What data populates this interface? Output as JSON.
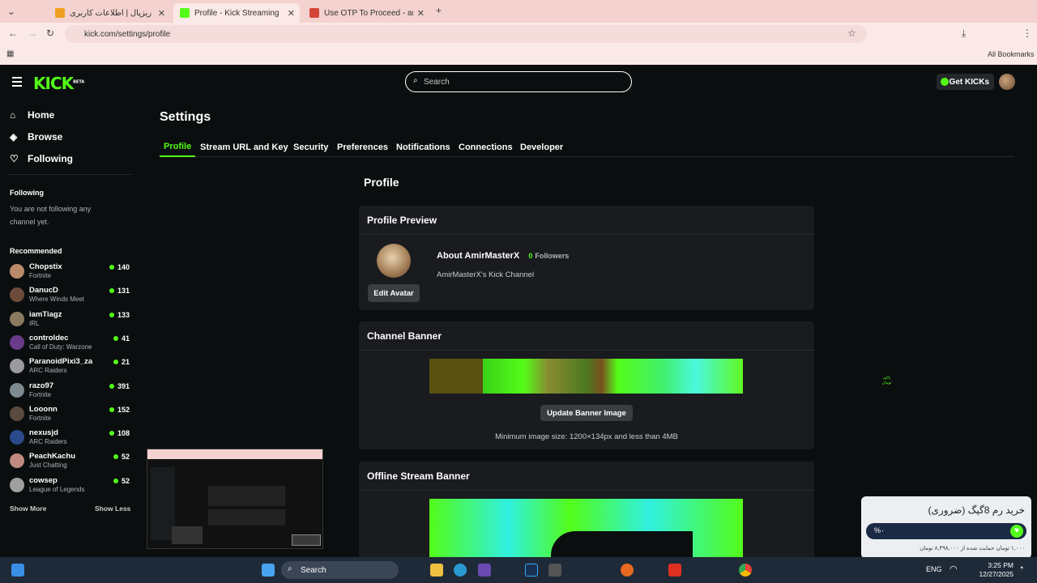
{
  "browser": {
    "tabs": [
      {
        "title": "ریزپال | اطلاعات کاربری",
        "active": false
      },
      {
        "title": "Profile - Kick Streaming",
        "active": true
      },
      {
        "title": "Use OTP To Proceed - amirban...",
        "active": false
      }
    ],
    "url": "kick.com/settings/profile",
    "bookmarks_label": "All Bookmarks"
  },
  "header": {
    "logo": "KICK",
    "logo_badge": "BETA",
    "search_placeholder": "Search",
    "get_kicks": "Get KICKs"
  },
  "sidebar": {
    "nav": [
      {
        "label": "Home",
        "icon": "home-icon"
      },
      {
        "label": "Browse",
        "icon": "compass-icon"
      },
      {
        "label": "Following",
        "icon": "heart-icon"
      }
    ],
    "following_heading": "Following",
    "following_empty": "You are not following any channel yet.",
    "recommended_heading": "Recommended",
    "recommended": [
      {
        "name": "Chopstix",
        "category": "Fortnite",
        "viewers": "140",
        "color": "#b98a6a"
      },
      {
        "name": "DanucD",
        "category": "Where Winds Meet",
        "viewers": "131",
        "color": "#6d4b3a"
      },
      {
        "name": "iamTiagz",
        "category": "IRL",
        "viewers": "133",
        "color": "#8a7a60"
      },
      {
        "name": "controldec",
        "category": "Call of Duty: Warzone",
        "viewers": "41",
        "color": "#6a3b8a"
      },
      {
        "name": "ParanoidPixi3_za",
        "category": "ARC Raiders",
        "viewers": "21",
        "color": "#9a9aa0"
      },
      {
        "name": "razo97",
        "category": "Fortnite",
        "viewers": "391",
        "color": "#7d8a90"
      },
      {
        "name": "Looonn",
        "category": "Fortnite",
        "viewers": "152",
        "color": "#5a4a40"
      },
      {
        "name": "nexusjd",
        "category": "ARC Raiders",
        "viewers": "108",
        "color": "#2a4a8a"
      },
      {
        "name": "PeachKachu",
        "category": "Just Chatting",
        "viewers": "52",
        "color": "#c08a80"
      },
      {
        "name": "cowsep",
        "category": "League of Legends",
        "viewers": "52",
        "color": "#a0a0a0"
      }
    ],
    "show_more": "Show More",
    "show_less": "Show Less"
  },
  "settings": {
    "title": "Settings",
    "tabs": [
      "Profile",
      "Stream URL and Key",
      "Security",
      "Preferences",
      "Notifications",
      "Connections",
      "Developer"
    ],
    "active_tab": "Profile",
    "section_title": "Profile",
    "profile_preview": {
      "heading": "Profile Preview",
      "about": "About AmirMasterX",
      "followers_count": "0",
      "followers_label": "Followers",
      "bio": "AmirMasterX's Kick Channel",
      "edit_avatar": "Edit Avatar"
    },
    "channel_banner": {
      "heading": "Channel Banner",
      "button": "Update Banner Image",
      "hint": "Minimum image size: 1200×134px and less than 4MB"
    },
    "offline_banner": {
      "heading": "Offline Stream Banner"
    }
  },
  "side_note": "تاکید\nتومان",
  "popup": {
    "title": "خرید رم 8گیگ (ضروری)",
    "percent": "%۰",
    "footer": "۱,۰۰۰ تومان حمایت شده از ۸,۴۹۸,۰۰۰ تومان"
  },
  "taskbar": {
    "search": "Search",
    "lang": "ENG",
    "time": "3:25 PM",
    "date": "12/27/2025"
  },
  "colors": {
    "accent": "#53fc18",
    "background": "#0b0e0f",
    "card": "#191b1f"
  }
}
